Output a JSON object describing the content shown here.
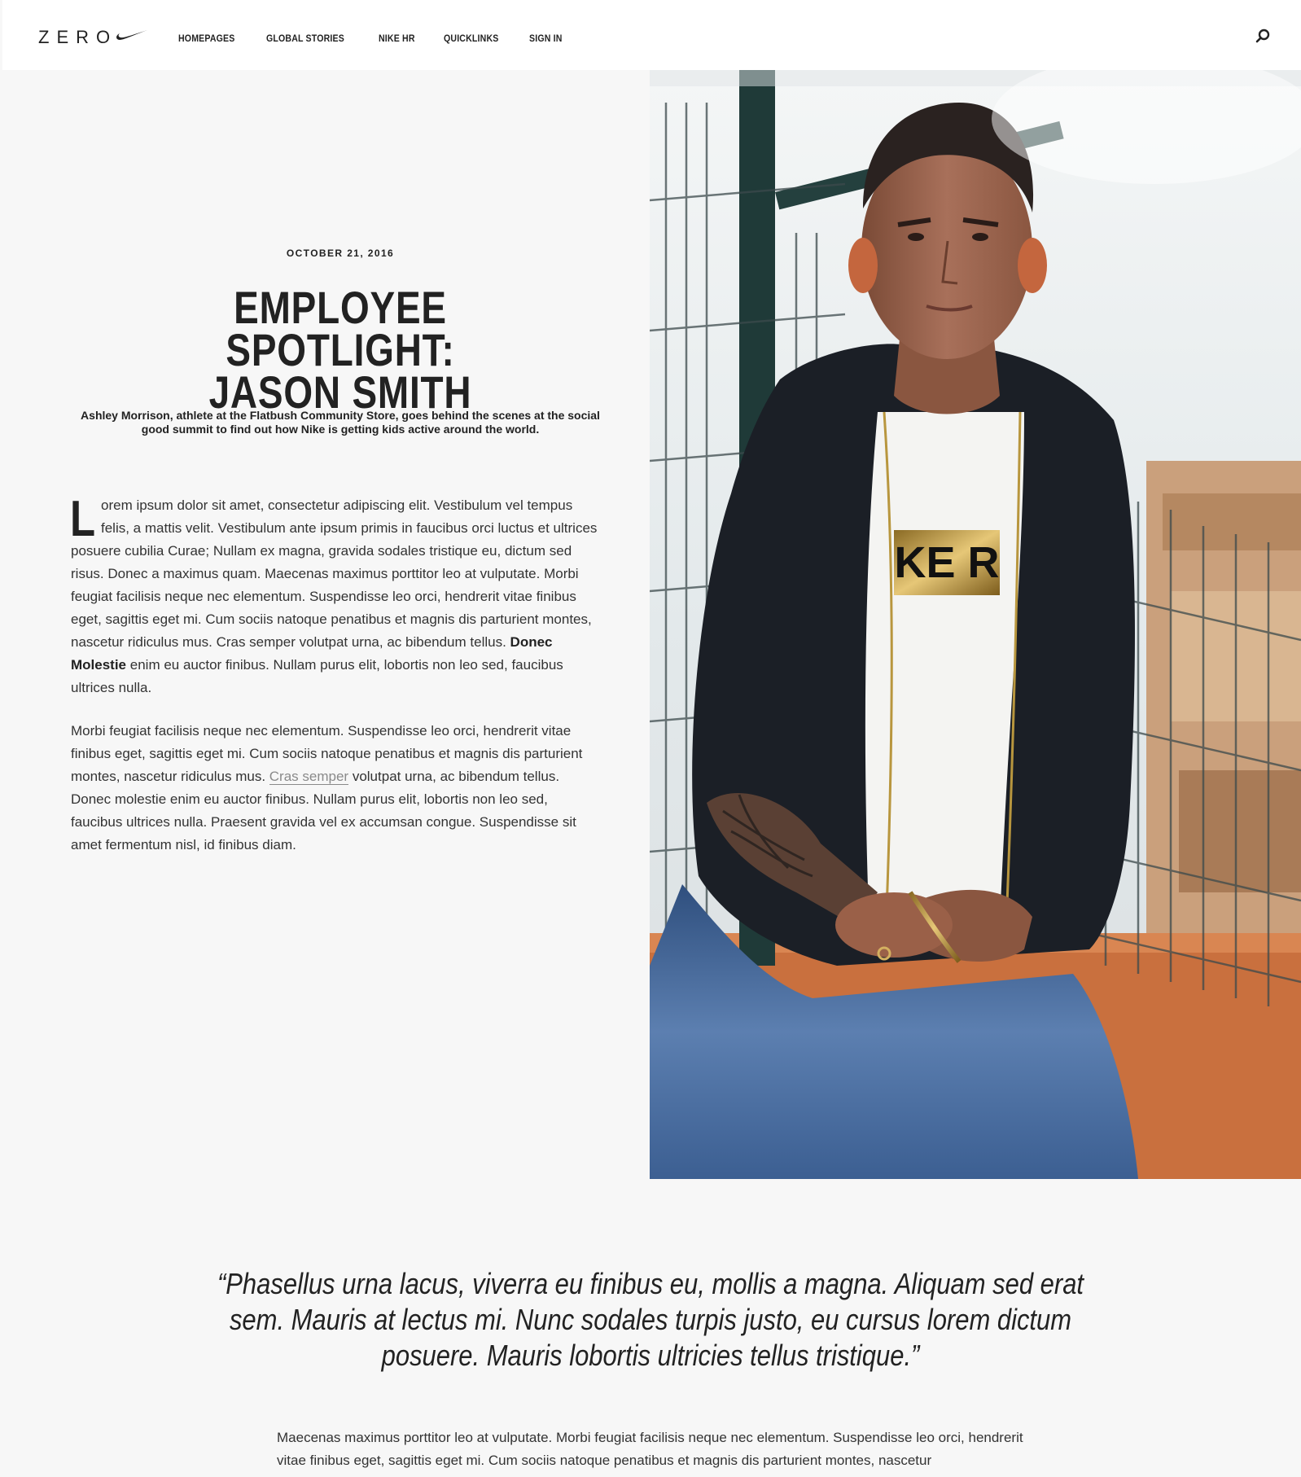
{
  "header": {
    "logo_text": "ZERO",
    "nav": [
      "HOMEPAGES",
      "GLOBAL STORIES",
      "NIKE HR",
      "QUICKLINKS",
      "SIGN IN"
    ]
  },
  "article": {
    "date": "OCTOBER 21, 2016",
    "title_line1": "EMPLOYEE SPOTLIGHT:",
    "title_line2": "JASON SMITH",
    "subtitle": "Ashley Morrison, athlete at the Flatbush Community Store, goes behind the scenes at the social good summit to find out how Nike is getting kids active around the world.",
    "para1": {
      "dropcap": "L",
      "text_a": "orem ipsum dolor sit amet, consectetur adipiscing elit. Vestibulum vel tempus felis, a mattis velit. Vestibulum ante ipsum primis in faucibus orci luctus et ultrices posuere cubilia Curae; Nullam ex magna, gravida sodales tristique eu, dictum sed risus. Donec a maximus quam. Maecenas maximus porttitor leo at vulputate. Morbi feugiat facilisis neque nec elementum. Suspendisse leo orci, hendrerit vitae finibus eget, sagittis eget mi. Cum sociis natoque penatibus et magnis dis parturient montes, nascetur ridiculus mus. Cras semper volutpat urna, ac bibendum tellus.",
      "bold": "Donec Molestie",
      "text_b": "enim eu auctor finibus. Nullam purus elit, lobortis non leo sed, faucibus ultrices nulla."
    },
    "para2": {
      "text_a": "Morbi feugiat facilisis neque nec elementum. Suspendisse leo orci, hendrerit vitae finibus eget, sagittis eget mi. Cum sociis natoque penatibus et magnis dis parturient montes, nascetur ridiculus mus.",
      "link": "Cras semper",
      "text_b": "volutpat urna, ac bibendum tellus. Donec molestie enim eu auctor finibus. Nullam purus elit, lobortis non leo sed, faucibus ultrices nulla. Praesent gravida vel ex accumsan congue. Suspendisse sit amet fermentum nisl, id finibus diam."
    },
    "quote": "“Phasellus urna lacus, viverra eu finibus eu, mollis a magna. Aliquam sed erat sem. Mauris at lectus mi. Nunc sodales turpis justo, eu cursus lorem dictum posuere. Mauris lobortis ultricies tellus tristique.”",
    "para3": "Maecenas maximus porttitor leo at vulputate. Morbi feugiat facilisis neque nec elementum. Suspendisse leo orci, hendrerit vitae finibus eget, sagittis eget mi. Cum sociis natoque penatibus et magnis dis parturient montes, nascetur",
    "hero_tshirt_text": "KE R"
  },
  "colors": {
    "background": "#f7f7f7",
    "header_bg": "#ffffff",
    "text_dark": "#222222",
    "text_body": "#333333",
    "link_gray": "#8a8a8a",
    "jacket": "#1b1f26",
    "jeans": "#3a5a8c",
    "gold": "#c9a24a"
  }
}
